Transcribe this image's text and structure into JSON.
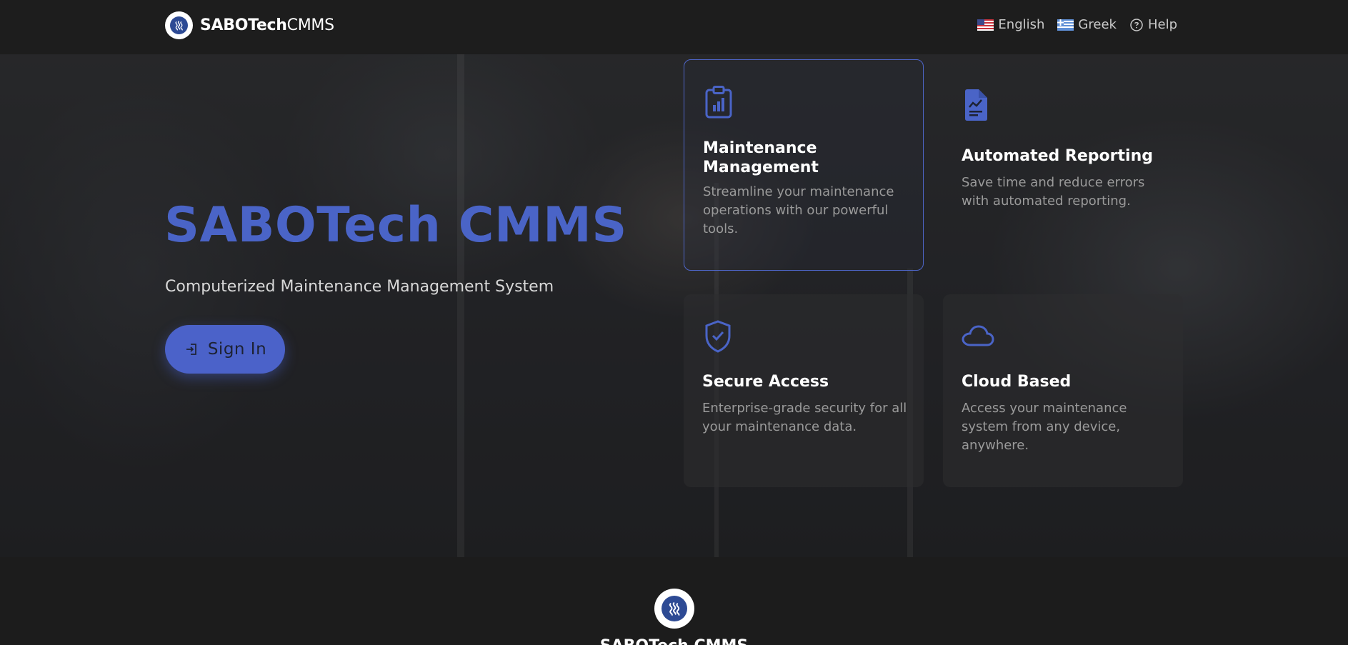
{
  "header": {
    "brand_bold": "SABOTech",
    "brand_light": "CMMS",
    "nav": [
      {
        "label": "English",
        "icon": "us-flag-icon"
      },
      {
        "label": "Greek",
        "icon": "greek-flag-icon"
      },
      {
        "label": "Help",
        "icon": "help-circle-icon"
      }
    ]
  },
  "hero": {
    "title": "SABOTech CMMS",
    "subtitle": "Computerized Maintenance Management System",
    "signin_label": "Sign In"
  },
  "features": [
    {
      "title": "Maintenance Management",
      "desc": "Streamline your maintenance operations with our powerful tools.",
      "icon": "clipboard-chart-icon"
    },
    {
      "title": "Automated Reporting",
      "desc": "Save time and reduce errors with automated reporting.",
      "icon": "report-document-icon"
    },
    {
      "title": "Secure Access",
      "desc": "Enterprise-grade security for all your maintenance data.",
      "icon": "shield-check-icon"
    },
    {
      "title": "Cloud Based",
      "desc": "Access your maintenance system from any device, anywhere.",
      "icon": "cloud-icon"
    }
  ],
  "footer": {
    "brand": "SABOTech CMMS"
  },
  "colors": {
    "accent": "#4a64c7",
    "header_bg": "#1d1d1d",
    "card_border": "#4e66c9"
  }
}
